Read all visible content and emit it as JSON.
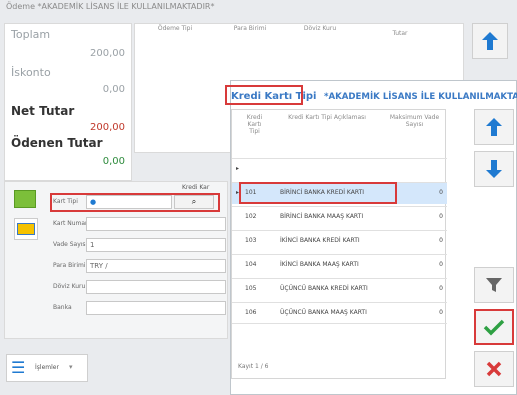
{
  "window": {
    "title": "Ödeme *AKADEMİK LİSANS İLE KULLANILMAKTADIR*"
  },
  "summary": {
    "toplam_label": "Toplam",
    "toplam_value": "200,00",
    "iskonto_label": "İskonto",
    "iskonto_value": "0,00",
    "net_label": "Net Tutar",
    "net_value": "200,00",
    "odenen_label": "Ödenen Tutar",
    "odenen_value": "0,00"
  },
  "payment_grid": {
    "headers": [
      "Ödeme Tipi",
      "Para Birimi",
      "Döviz Kuru",
      "Tutar"
    ]
  },
  "form": {
    "section_label": "Kredi Kar",
    "kart_tipi_label": "Kart Tipi",
    "kart_numarasi_label": "Kart Numarası",
    "vade_sayisi_label": "Vade Sayısı",
    "vade_sayisi_value": "1",
    "para_birimi_label": "Para Birimi",
    "para_birimi_value": "TRY /",
    "doviz_kuru_label": "Döviz Kuru",
    "banka_label": "Banka"
  },
  "bottom": {
    "islemler_label": "İşlemler"
  },
  "popup": {
    "title": "Kredi Kartı Tipi",
    "title_suffix": "*AKADEMİK LİSANS İLE KULLANILMAKTADIR*",
    "headers": [
      "Kredi Kartı Tipi",
      "Kredi Kartı Tipi Açıklaması",
      "Maksimum Vade Sayısı"
    ],
    "rows": [
      {
        "code": "101",
        "desc": "BİRİNCİ BANKA KREDİ KARTI",
        "max": "0"
      },
      {
        "code": "102",
        "desc": "BİRİNCİ BANKA MAAŞ KARTI",
        "max": "0"
      },
      {
        "code": "103",
        "desc": "İKİNCİ BANKA KREDİ KARTI",
        "max": "0"
      },
      {
        "code": "104",
        "desc": "İKİNCİ BANKA MAAŞ KARTI",
        "max": "0"
      },
      {
        "code": "105",
        "desc": "ÜÇÜNCÜ BANKA KREDİ KARTI",
        "max": "0"
      },
      {
        "code": "106",
        "desc": "ÜÇÜNCÜ BANKA MAAŞ KARTI",
        "max": "0"
      }
    ],
    "record_label": "Kayıt 1 / 6"
  },
  "colors": {
    "accent": "#1f7ad1",
    "danger": "#d83a3a",
    "success": "#2ea043"
  }
}
